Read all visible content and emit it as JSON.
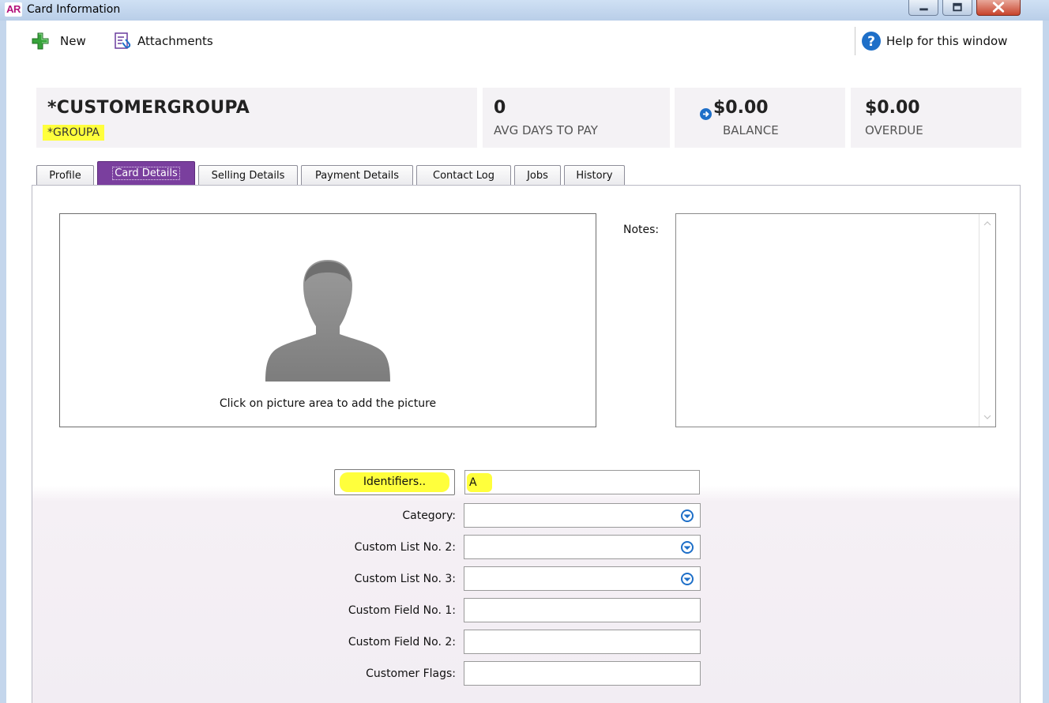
{
  "window": {
    "app_badge": "AR",
    "title": "Card Information"
  },
  "toolbar": {
    "new_label": "New",
    "attachments_label": "Attachments",
    "help_label": "Help for this window"
  },
  "summary": {
    "name": "*CUSTOMERGROUPA",
    "code": "*GROUPA",
    "avg_days_value": "0",
    "avg_days_label": "AVG DAYS TO PAY",
    "balance_value": "$0.00",
    "balance_label": "BALANCE",
    "overdue_value": "$0.00",
    "overdue_label": "OVERDUE"
  },
  "tabs": [
    {
      "label": "Profile"
    },
    {
      "label": "Card Details",
      "active": true
    },
    {
      "label": "Selling Details"
    },
    {
      "label": "Payment Details"
    },
    {
      "label": "Contact Log"
    },
    {
      "label": "Jobs"
    },
    {
      "label": "History"
    }
  ],
  "picture": {
    "caption": "Click on picture area to add the picture"
  },
  "notes": {
    "label": "Notes:",
    "value": ""
  },
  "form": {
    "identifiers_button": "Identifiers..",
    "identifiers_value": "A",
    "category_label": "Category:",
    "category_value": "",
    "custom_list_2_label": "Custom List No. 2:",
    "custom_list_2_value": "",
    "custom_list_3_label": "Custom List No. 3:",
    "custom_list_3_value": "",
    "custom_field_1_label": "Custom Field No. 1:",
    "custom_field_1_value": "",
    "custom_field_2_label": "Custom Field No. 2:",
    "custom_field_2_value": "",
    "customer_flags_label": "Customer Flags:",
    "customer_flags_value": ""
  },
  "colors": {
    "active_tab": "#7a3f9e",
    "highlight": "#ffff3c",
    "accent_blue": "#1e6fc8"
  },
  "icons": {
    "new": "plus-icon",
    "attachments": "attachment-icon",
    "help": "help-icon",
    "balance": "arrow-right-circle-icon",
    "dropdown": "chevron-down-circle-icon"
  }
}
